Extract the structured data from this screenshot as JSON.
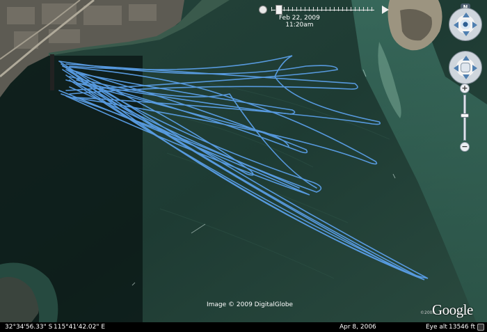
{
  "time_slider": {
    "date": "Feb 22, 2009",
    "time": "11:20am"
  },
  "compass": {
    "north_label": "N"
  },
  "zoom": {
    "in_label": "+",
    "out_label": "−"
  },
  "imagery_credit": "Image © 2009 DigitalGlobe",
  "logo": {
    "year": "©2008",
    "text": "Google"
  },
  "status_bar": {
    "latitude": "32°34'56.33\" S",
    "longitude": "115°41'42.02\" E",
    "imagery_date": "Apr  8, 2006",
    "eye_alt_label": "Eye alt",
    "eye_alt": "13546 ft"
  },
  "colors": {
    "track": "#5a9fe8",
    "water": "#1d3a33",
    "shallow_water": "#3f7a6c",
    "land": "#5f5e57"
  },
  "icons": [
    "clock-icon",
    "play-icon",
    "eye-icon",
    "hand-icon",
    "streaming-icon"
  ]
}
